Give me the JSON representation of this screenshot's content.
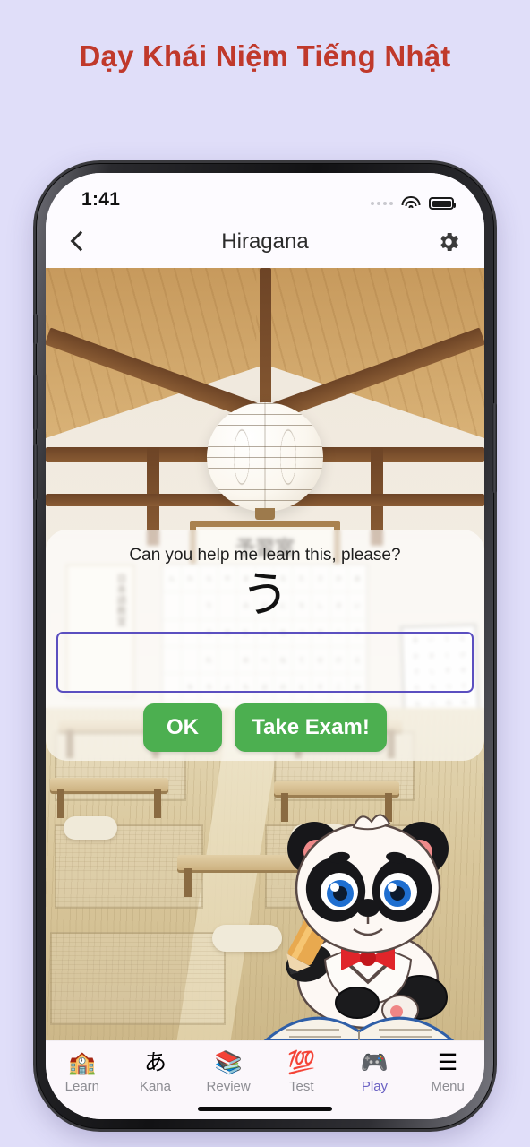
{
  "page": {
    "title": "Dạy Khái Niệm Tiếng Nhật",
    "title_color": "#c0392b",
    "background_color": "#e0def9"
  },
  "status_bar": {
    "time": "1:41",
    "signal_icon": "signal-dots-icon",
    "wifi_icon": "wifi-icon",
    "battery_icon": "battery-icon"
  },
  "nav_bar": {
    "back_icon": "back-chevron-icon",
    "title": "Hiragana",
    "settings_icon": "gear-icon"
  },
  "scene": {
    "sign_text": "予習室",
    "scroll_text": "日本語教室",
    "description": "traditional japanese tatami classroom"
  },
  "dialog": {
    "prompt": "Can you help me learn this, please?",
    "character": "う",
    "input_value": "",
    "input_placeholder": "",
    "input_border_color": "#5b4fc0",
    "buttons": {
      "ok_label": "OK",
      "exam_label": "Take Exam!",
      "color": "#4caf50"
    }
  },
  "mascot": {
    "name": "panda-mascot",
    "description": "cartoon panda with pencil, red bow tie and open book"
  },
  "tab_bar": {
    "active_index": 4,
    "active_color": "#6c63c4",
    "inactive_color": "#8d8d93",
    "items": [
      {
        "label": "Learn",
        "icon": "🏫",
        "icon_name": "school-icon"
      },
      {
        "label": "Kana",
        "icon": "あ",
        "icon_name": "kana-a-icon"
      },
      {
        "label": "Review",
        "icon": "📚",
        "icon_name": "books-icon"
      },
      {
        "label": "Test",
        "icon": "💯",
        "icon_name": "hundred-points-icon"
      },
      {
        "label": "Play",
        "icon": "🎮",
        "icon_name": "gamepad-icon"
      },
      {
        "label": "Menu",
        "icon": "☰",
        "icon_name": "hamburger-menu-icon"
      }
    ]
  }
}
